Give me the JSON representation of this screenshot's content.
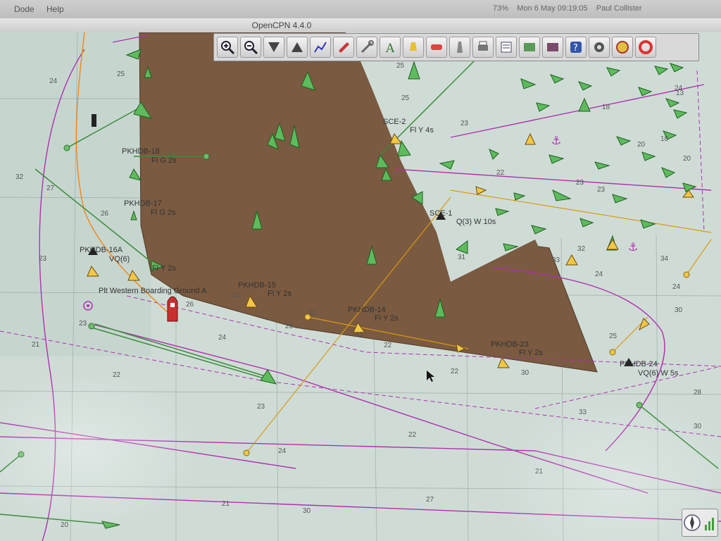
{
  "menubar": {
    "items": [
      "Dode",
      "Help"
    ],
    "battery": "73%",
    "clock": "Mon 6 May  09:19:05",
    "user": "Paul Collister"
  },
  "window": {
    "title": "OpenCPN 4.4.0"
  },
  "toolbar": {
    "buttons": [
      "zoom-in-icon",
      "zoom-out-icon",
      "scale-down-icon",
      "scale-up-icon",
      "route-icon",
      "ship-icon",
      "wrench-icon",
      "text-icon",
      "lamp-icon",
      "ais-icon",
      "lighthouse-icon",
      "print-icon",
      "list-icon",
      "tide-icon",
      "current-icon",
      "help-icon",
      "settings-icon",
      "mob-icon",
      "lifebuoy-icon"
    ]
  },
  "chart": {
    "labels": {
      "pkhdb18": "PKHDB-18",
      "pkhdb18_light": "Fl G 2s",
      "pkhdb17": "PKHDB-17",
      "pkhdb17_light": "Fl G 2s",
      "pkhdb16a": "PKHDB-16A",
      "pkhdb16a_light": "VQ(6)",
      "pkhdb16_light": "Fl Y 2s",
      "pkhdb15": "PKHDB-15",
      "pkhdb15_light": "Fl Y 2s",
      "pkhdb14": "PKHDB-14",
      "pkhdb14_light": "Fl Y 2s",
      "pkhdb23": "PKHDB-23",
      "pkhdb23_light": "Fl Y 2s",
      "pkhdb24": "PKHDB-24",
      "pkhdb24_light": "VQ(6) W 5s",
      "sce2": "SCE-2",
      "sce2_light": "Fl Y 4s",
      "sce1": "SCE-1",
      "sce1_light": "Q(3) W 10s",
      "boarding": "Plt Western Boarding Ground A"
    },
    "soundings": [
      "24",
      "25",
      "32",
      "27",
      "26",
      "23",
      "23",
      "21",
      "22",
      "24",
      "30",
      "20",
      "33",
      "25",
      "22",
      "23",
      "24",
      "22",
      "27",
      "30",
      "21",
      "21",
      "22",
      "23",
      "31",
      "32",
      "33",
      "33",
      "34",
      "24",
      "30",
      "28",
      "30",
      "25",
      "24",
      "23",
      "20",
      "18",
      "13",
      "25",
      "23",
      "25",
      "26",
      "31",
      "30",
      "24",
      "22",
      "20",
      "18"
    ]
  },
  "colors": {
    "sea": "#cfdcd6",
    "land": "#7a5a40",
    "magenta": "#b030b0",
    "ais_green": "#3a8a3a",
    "buoy_yellow": "#e6b820"
  }
}
